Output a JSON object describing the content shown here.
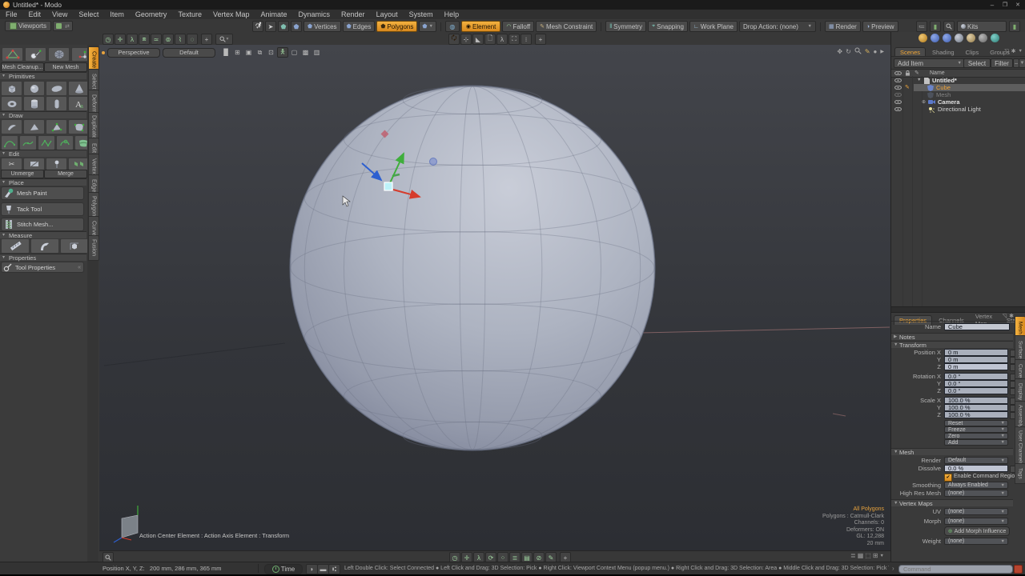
{
  "window": {
    "title": "Untitled* - Modo",
    "minimize": "–",
    "restore": "❐",
    "close": "✕"
  },
  "menubar": [
    "File",
    "Edit",
    "View",
    "Select",
    "Item",
    "Geometry",
    "Texture",
    "Vertex Map",
    "Animate",
    "Dynamics",
    "Render",
    "Layout",
    "System",
    "Help"
  ],
  "toolbar": {
    "viewports": "Viewports",
    "vertices": "Vertices",
    "edges": "Edges",
    "polygons": "Polygons",
    "element": "Element",
    "falloff": "Falloff",
    "mesh_constraint": "Mesh Constraint",
    "symmetry": "Symmetry",
    "snapping": "Snapping",
    "work_plane": "Work Plane",
    "drop_action": "Drop Action: (none)",
    "render": "Render",
    "preview": "Preview",
    "kits": "Kits"
  },
  "sidebar": {
    "mesh_cleanup": "Mesh Cleanup...",
    "new_mesh": "New Mesh",
    "primitives": "Primitives",
    "draw": "Draw",
    "edit": "Edit",
    "place": "Place",
    "measure": "Measure",
    "properties": "Properties",
    "unmerge": "Unmerge",
    "merge": "Merge",
    "mesh_paint": "Mesh Paint",
    "tack_tool": "Tack Tool",
    "stitch_mesh": "Stitch Mesh...",
    "tool_properties": "Tool Properties",
    "tabs": [
      "Create",
      "Select",
      "Deform",
      "Duplicate",
      "Edit",
      "Vertex",
      "Edge",
      "Polygon",
      "Curve",
      "Fusion"
    ]
  },
  "viewport": {
    "camera": "Perspective",
    "shading": "Default",
    "info": [
      "All Polygons",
      "Polygons : Catmull-Clark",
      "Channels: 0",
      "Deformers: ON",
      "GL: 12,288",
      "20 mm"
    ],
    "action_status": "Action Center Element : Action Axis Element : Transform"
  },
  "items": {
    "tabs": [
      "Scenes",
      "Shading",
      "Clips",
      "Groups"
    ],
    "add_item": "Add Item",
    "select": "Select",
    "filter": "Filter",
    "name": "Name",
    "rows": [
      "Untitled*",
      "Cube",
      "Mesh",
      "Camera",
      "Directional Light"
    ]
  },
  "props": {
    "tabs": [
      "Properties",
      "Channels",
      "Vertex Map",
      "Stats"
    ],
    "name_label": "Name",
    "name": "Cube",
    "notes": "Notes",
    "transform": "Transform",
    "position_x": "Position X",
    "rotation_x": "Rotation X",
    "scale_x": "Scale X",
    "y": "Y",
    "z": "Z",
    "pos": [
      "0 m",
      "0 m",
      "0 m"
    ],
    "rot": [
      "0.0 °",
      "0.0 °",
      "0.0 °"
    ],
    "scl": [
      "100.0 %",
      "100.0 %",
      "100.0 %"
    ],
    "actions": [
      "Reset",
      "Freeze",
      "Zero",
      "Add"
    ],
    "mesh": "Mesh",
    "render_label": "Render",
    "render": "Default",
    "dissolve_label": "Dissolve",
    "dissolve": "0.0 %",
    "enable_regions": "Enable Command Regions",
    "smoothing_label": "Smoothing",
    "smoothing": "Always Enabled",
    "highres_label": "High Res Mesh",
    "none": "(none)",
    "vertex_maps": "Vertex Maps",
    "uv": "UV",
    "morph": "Morph",
    "add_morph": "Add Morph Influence",
    "weight": "Weight",
    "side_tabs": [
      "Mesh",
      "Surface",
      "Curve",
      "Display",
      "Assembly",
      "User Channels",
      "Tags"
    ]
  },
  "status": {
    "position": "Position X, Y, Z:   200 mm, 286 mm, 365 mm",
    "time": "Time",
    "help": "Left Double Click: Select Connected ● Left Click and Drag: 3D Selection: Pick ● Right Click: Viewport Context Menu (popup menu.) ● Right Click and Drag: 3D Selection: Area ● Middle Click and Drag: 3D Selection: Pick Through ● [Any Key]-[Any Button] Click and Drag: dragDropBegin",
    "command": "Command"
  },
  "colors": {
    "accent": "#e8a33d",
    "selection_orange": "#f0a43a",
    "field_bg": "#aab0bc",
    "gizmo_red": "#d63c2c",
    "gizmo_green": "#3fae3c",
    "gizmo_blue": "#2d5fd0"
  }
}
